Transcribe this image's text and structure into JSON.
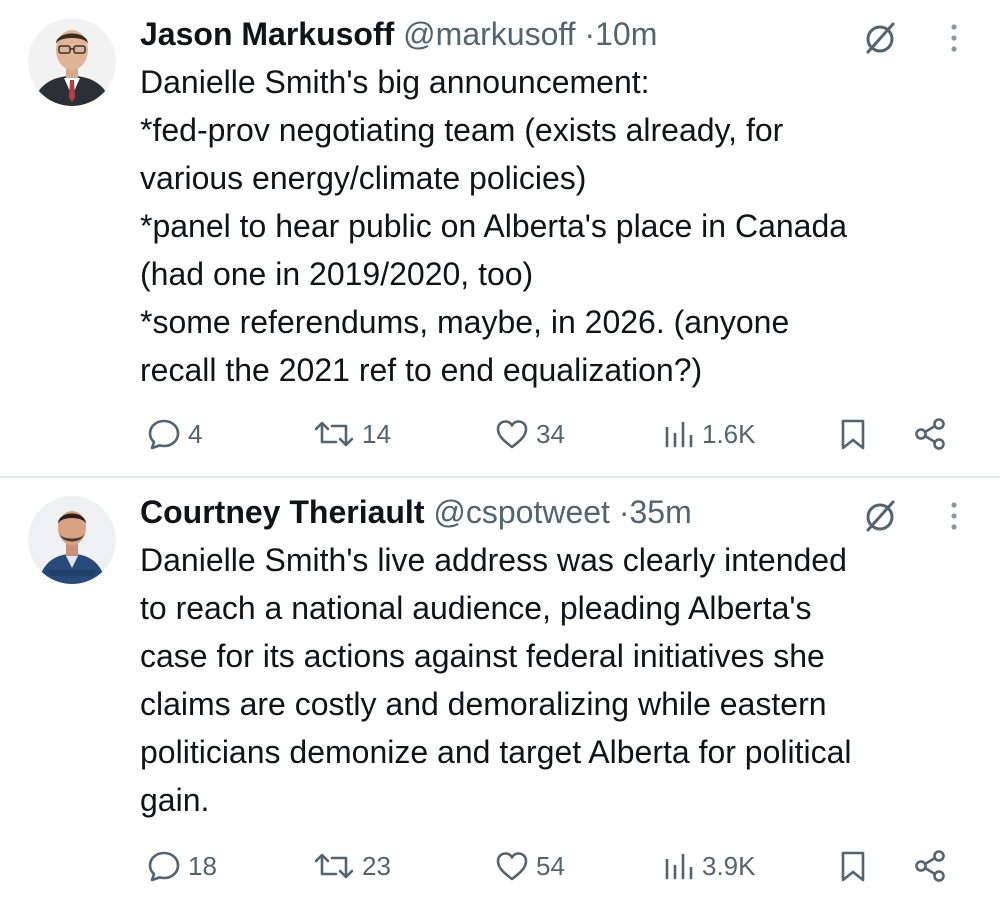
{
  "tweets": [
    {
      "name": "Jason Markusoff",
      "handle": "@markusoff",
      "separator": "·",
      "time": "10m",
      "lines": [
        "Danielle Smith's big announcement:",
        "*fed-prov negotiating team (exists already, for",
        "various energy/climate policies)",
        "*panel to hear public on Alberta's place in Canada",
        "(had one in 2019/2020, too)",
        "*some referendums, maybe, in 2026. (anyone",
        "recall the 2021 ref to end equalization?)"
      ],
      "replies": "4",
      "reposts": "14",
      "likes": "34",
      "views": "1.6K"
    },
    {
      "name": "Courtney Theriault",
      "handle": "@cspotweet",
      "separator": "·",
      "time": "35m",
      "lines": [
        "Danielle Smith's live address was clearly intended",
        "to reach a national audience, pleading Alberta's",
        "case for its actions against federal initiatives she",
        "claims are costly and demoralizing while eastern",
        "politicians demonize and target Alberta for political",
        "gain."
      ],
      "replies": "18",
      "reposts": "23",
      "likes": "54",
      "views": "3.9K"
    }
  ],
  "icons": {
    "reply": "reply-icon",
    "repost": "repost-icon",
    "like": "heart-icon",
    "views": "views-icon",
    "bookmark": "bookmark-icon",
    "share": "share-icon",
    "grok": "grok-icon",
    "more": "more-vertical-icon"
  },
  "colors": {
    "text": "#0f1419",
    "secondary": "#536471",
    "divider": "#e4e8eb"
  }
}
